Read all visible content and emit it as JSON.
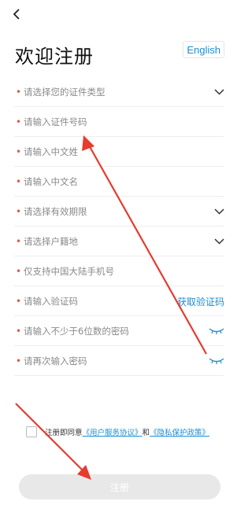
{
  "header": {
    "title": "欢迎注册",
    "language_button": "English"
  },
  "form": {
    "rows": [
      {
        "required": true,
        "label": "请选择您的证件类型",
        "right": "chevron-down-icon"
      },
      {
        "required": true,
        "label": "请输入证件号码",
        "right": ""
      },
      {
        "required": true,
        "label": "请输入中文姓",
        "right": ""
      },
      {
        "required": true,
        "label": "请输入中文名",
        "right": ""
      },
      {
        "required": true,
        "label": "请选择有效期限",
        "right": "chevron-down-icon"
      },
      {
        "required": true,
        "label": "请选择户籍地",
        "right": "chevron-down-icon"
      },
      {
        "required": true,
        "label": "仅支持中国大陆手机号",
        "right": ""
      },
      {
        "required": true,
        "label": "请输入验证码",
        "right": "link",
        "link_text": "获取验证码"
      },
      {
        "required": true,
        "label": "请输入不少于6位数的密码",
        "right": "eye-closed-icon"
      },
      {
        "required": true,
        "label": "请再次输入密码",
        "right": "eye-closed-icon"
      }
    ]
  },
  "agreement": {
    "prefix": "注册即同意",
    "terms_link": "《用户服务协议》",
    "and": "和",
    "privacy_link": "《隐私保护政策》",
    "checked": false
  },
  "submit": {
    "label": "注册",
    "enabled": false
  },
  "colors": {
    "accent": "#1b8fd2",
    "required": "#e0584b",
    "annotation_arrow": "#e63b2e",
    "button_disabled": "#e8e8e8"
  }
}
